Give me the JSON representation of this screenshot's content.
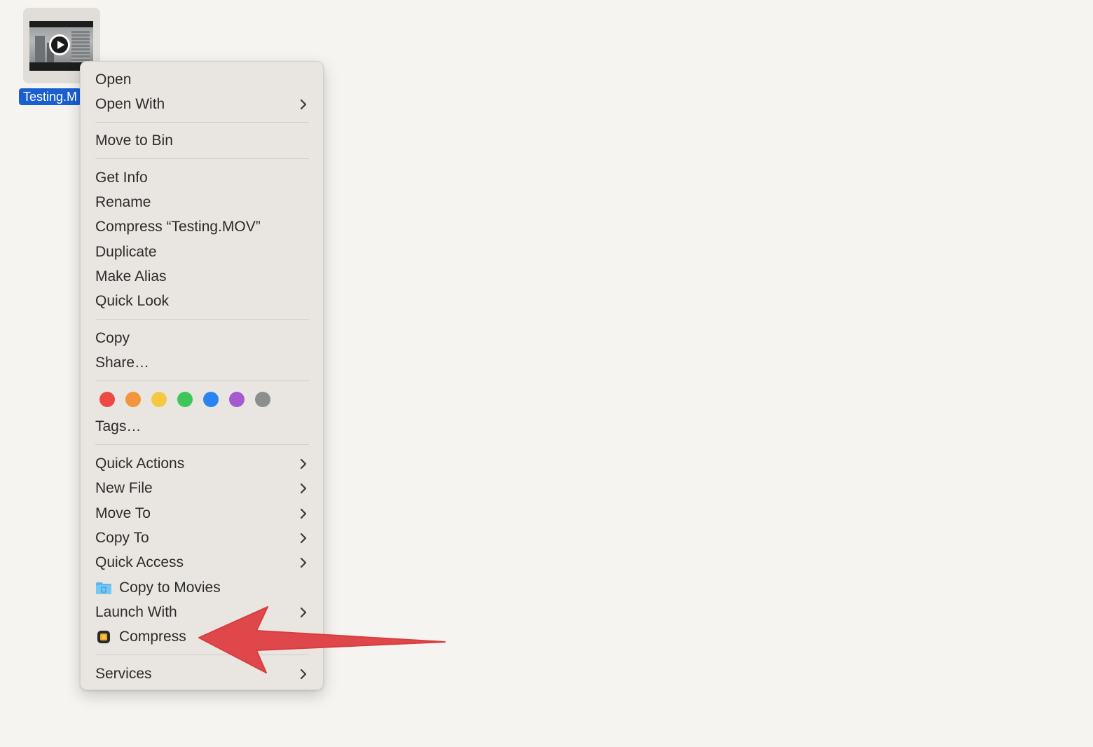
{
  "desktop": {
    "file": {
      "label": "Testing.M",
      "icon": "video-thumbnail-play-icon"
    }
  },
  "context_menu": {
    "items": [
      {
        "label": "Open",
        "submenu": false
      },
      {
        "label": "Open With",
        "submenu": true
      },
      {
        "label": "Move to Bin",
        "submenu": false
      },
      {
        "label": "Get Info",
        "submenu": false
      },
      {
        "label": "Rename",
        "submenu": false
      },
      {
        "label": "Compress “Testing.MOV”",
        "submenu": false
      },
      {
        "label": "Duplicate",
        "submenu": false
      },
      {
        "label": "Make Alias",
        "submenu": false
      },
      {
        "label": "Quick Look",
        "submenu": false
      },
      {
        "label": "Copy",
        "submenu": false
      },
      {
        "label": "Share…",
        "submenu": false
      },
      {
        "label": "Tags…",
        "submenu": false
      },
      {
        "label": "Quick Actions",
        "submenu": true
      },
      {
        "label": "New File",
        "submenu": true
      },
      {
        "label": "Move To",
        "submenu": true
      },
      {
        "label": "Copy To",
        "submenu": true
      },
      {
        "label": "Quick Access",
        "submenu": true
      },
      {
        "label": "Copy to Movies",
        "submenu": false,
        "icon": "folder-icon"
      },
      {
        "label": "Launch With",
        "submenu": true
      },
      {
        "label": "Compress",
        "submenu": false,
        "icon": "compress-app-icon"
      },
      {
        "label": "Services",
        "submenu": true
      }
    ],
    "tag_colors": [
      {
        "name": "red",
        "color": "#ee4a45"
      },
      {
        "name": "orange",
        "color": "#f2953b"
      },
      {
        "name": "yellow",
        "color": "#f6c842"
      },
      {
        "name": "green",
        "color": "#3ec65a"
      },
      {
        "name": "blue",
        "color": "#2a83f0"
      },
      {
        "name": "purple",
        "color": "#a55ad0"
      },
      {
        "name": "gray",
        "color": "#8e8e8f"
      }
    ]
  },
  "annotation": {
    "arrow_color": "#e0474a",
    "points_to": "Compress"
  }
}
